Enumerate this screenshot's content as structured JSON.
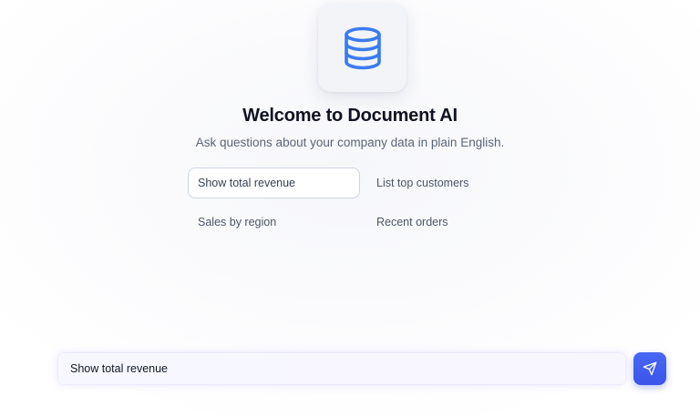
{
  "hero": {
    "icon": "database-icon",
    "icon_color": "#3b7bf0",
    "title": "Welcome to Document AI",
    "subtitle": "Ask questions about your company data in plain English."
  },
  "suggestions": [
    {
      "label": "Show total revenue",
      "selected": true
    },
    {
      "label": "List top customers",
      "selected": false
    },
    {
      "label": "Sales by region",
      "selected": false
    },
    {
      "label": "Recent orders",
      "selected": false
    }
  ],
  "chat": {
    "input_value": "Show total revenue",
    "send_icon": "send-icon",
    "accent_color": "#3f5cf0"
  }
}
